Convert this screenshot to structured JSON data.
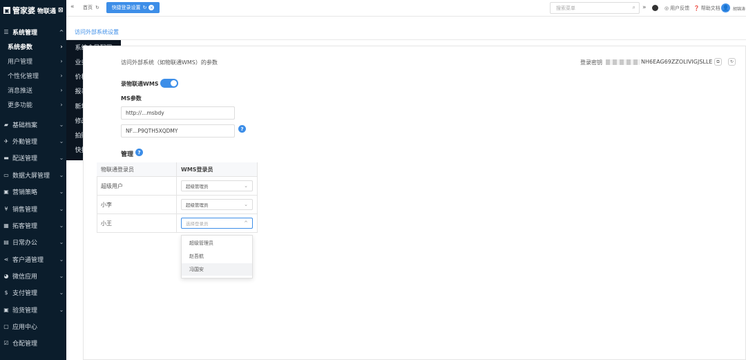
{
  "app": {
    "logo_text": "管家婆",
    "logo_sub": "物联通",
    "logo_mark": "⊠"
  },
  "sidebar": {
    "top_group": {
      "label": "系统管理",
      "icon": "sliders-icon"
    },
    "sub_items": [
      {
        "label": "系统参数",
        "active": true
      },
      {
        "label": "用户管理"
      },
      {
        "label": "个性化管理"
      },
      {
        "label": "消息推送"
      },
      {
        "label": "更多功能"
      }
    ],
    "items": [
      {
        "label": "基础档案"
      },
      {
        "label": "外勤管理"
      },
      {
        "label": "配送管理"
      },
      {
        "label": "数据大屏管理"
      },
      {
        "label": "营销策略"
      },
      {
        "label": "销售管理"
      },
      {
        "label": "拓客管理"
      },
      {
        "label": "日常办公"
      },
      {
        "label": "客户通管理"
      },
      {
        "label": "微信应用"
      },
      {
        "label": "支付管理"
      },
      {
        "label": "验货管理"
      },
      {
        "label": "应用中心"
      },
      {
        "label": "仓配管理"
      }
    ]
  },
  "flyout": {
    "items": [
      "系统全局配置",
      "业务录单配置",
      "价格优先级别",
      "报表单据设置",
      "新增客户字段",
      "修改客户字段",
      "拍照水印配置",
      "快捷登录设置"
    ]
  },
  "topbar": {
    "collapse": "«",
    "home_tab": "首页",
    "active_tab": "快捷登录设置",
    "search_placeholder": "搜索菜单",
    "more": "»",
    "feedback": "用户反馈",
    "help": "帮助文档",
    "user": "胡锦涛"
  },
  "page": {
    "breadcrumb": "访问外部系统设置",
    "description": "访问外部系统（如物联通WMS）的参数",
    "login_key_label": "登录密钥",
    "login_key_value": "NH6EAG69ZZOLIVIGJSLLE",
    "toggle_label": "录物联通WMS",
    "toggle_on": true,
    "params_heading": "MS参数",
    "url_value": "http://…msbdy",
    "key_value": "NF…P9QTH5XQDMY",
    "mapping_heading": "管理"
  },
  "mapping_table": {
    "headers": [
      "物联通登录员",
      "WMS登录员"
    ],
    "rows": [
      {
        "user": "超级用户",
        "wms": "超级管理员"
      },
      {
        "user": "小李",
        "wms": "超级管理员"
      },
      {
        "user": "小王",
        "wms": "",
        "placeholder": "选择登录员"
      }
    ]
  },
  "dropdown": {
    "options": [
      "超级管理员",
      "赵吾航",
      "冯国安"
    ]
  },
  "colors": {
    "primary": "#3d8ee8",
    "sidebar": "#0b1d2c",
    "flyout": "#0b1520"
  }
}
